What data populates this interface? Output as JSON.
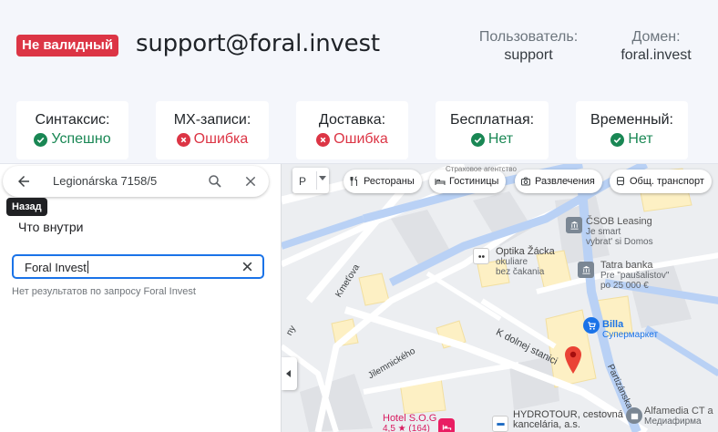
{
  "validation": {
    "status_badge": "Не валидный",
    "email": "support@foral.invest",
    "user_label": "Пользователь:",
    "user_value": "support",
    "domain_label": "Домен:",
    "domain_value": "foral.invest",
    "checks": [
      {
        "label": "Синтаксис:",
        "result": "Успешно",
        "status": "ok"
      },
      {
        "label": "MX-записи:",
        "result": "Ошибка",
        "status": "bad"
      },
      {
        "label": "Доставка:",
        "result": "Ошибка",
        "status": "bad"
      },
      {
        "label": "Бесплатная:",
        "result": "Нет",
        "status": "ok"
      },
      {
        "label": "Временный:",
        "result": "Нет",
        "status": "ok"
      }
    ],
    "colors": {
      "ok": "#198754",
      "bad": "#dc3545"
    }
  },
  "sidebar": {
    "search_query": "Legionárska 7158/5",
    "back_tooltip": "Назад",
    "section_title": "Что внутри",
    "inner_search_value": "Foral Invest",
    "no_results": "Нет результатов по запросу Foral Invest"
  },
  "map": {
    "map_type": "Р",
    "chips": [
      {
        "label": "Рестораны",
        "icon": "fork-knife-icon"
      },
      {
        "label": "Гостиницы",
        "icon": "bed-icon"
      },
      {
        "label": "Развлечения",
        "icon": "camera-icon"
      },
      {
        "label": "Общ. транспорт",
        "icon": "bus-icon"
      }
    ],
    "pois": {
      "csob_name": "ČSOB Leasing",
      "csob_sub1": "Je smart",
      "csob_sub2": "vybrat' si Domos",
      "optika_name": "Optika Žácka",
      "optika_sub1": "okuliare",
      "optika_sub2": "bez čakania",
      "tatra_name": "Tatra banka",
      "tatra_sub1": "Pre \"paušalistov\"",
      "tatra_sub2": "po 25 000 €",
      "billa_name": "Billa",
      "billa_sub": "Супермаркет",
      "hydrotour_name": "HYDROTOUR, cestovná",
      "hydrotour_sub": "kancelária, a.s.",
      "hotel_name": "Hotel S.O.G",
      "hotel_rating": "4,5 ★ (164)",
      "alfamedia_name": "Alfamedia CT a",
      "alfamedia_sub": "Медиафирма",
      "top_label": "Страховое агентство"
    },
    "streets": {
      "kmetova": "Kmeťova",
      "k_dolnej": "K dolnej stanici",
      "jilemnickeho": "Jilemnického",
      "partizanska": "Partizánska",
      "left_edge": "ny"
    },
    "colors": {
      "pin": "#ea4335",
      "blue_road": "#aecbfa",
      "building": "#fdf0c4"
    }
  }
}
